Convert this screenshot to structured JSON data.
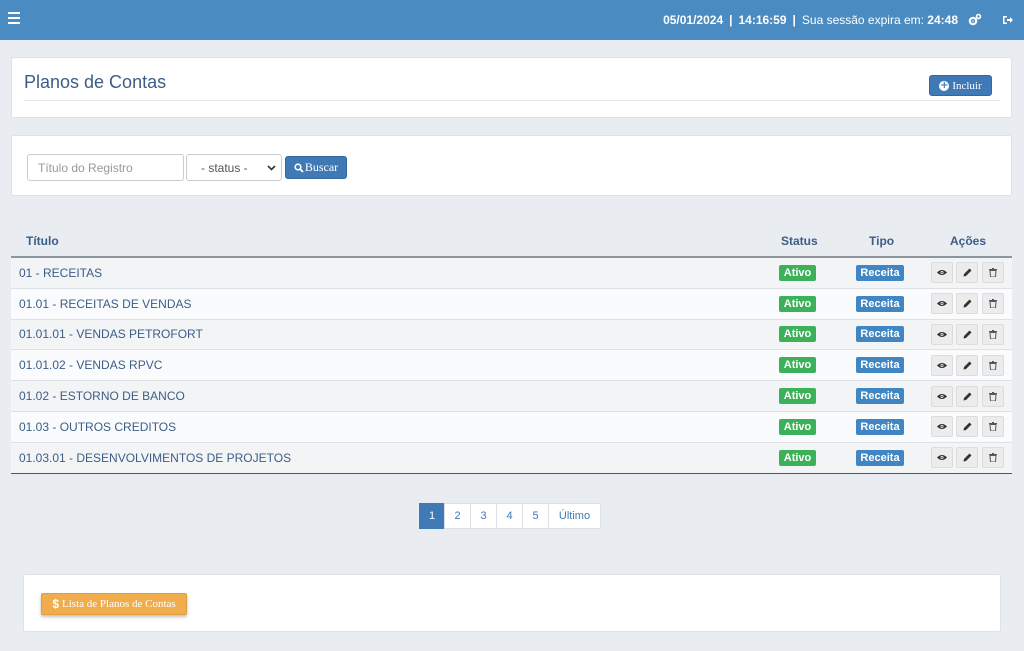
{
  "topbar": {
    "date": "05/01/2024",
    "separator": "|",
    "time": "14:16:59",
    "session_label": "Sua sessão expira em:",
    "session_time": "24:48"
  },
  "header": {
    "title": "Planos de Contas",
    "include_label": "Incluir"
  },
  "search": {
    "placeholder": "Título do Registro",
    "status_selected": "- status -",
    "button_label": "Buscar"
  },
  "table": {
    "columns": {
      "titulo": "Título",
      "status": "Status",
      "tipo": "Tipo",
      "acoes": "Ações"
    },
    "rows": [
      {
        "titulo": "01 - RECEITAS",
        "status": "Ativo",
        "tipo": "Receita"
      },
      {
        "titulo": "01.01 - RECEITAS DE VENDAS",
        "status": "Ativo",
        "tipo": "Receita"
      },
      {
        "titulo": "01.01.01 - VENDAS PETROFORT",
        "status": "Ativo",
        "tipo": "Receita"
      },
      {
        "titulo": "01.01.02 - VENDAS RPVC",
        "status": "Ativo",
        "tipo": "Receita"
      },
      {
        "titulo": "01.02 - ESTORNO DE BANCO",
        "status": "Ativo",
        "tipo": "Receita"
      },
      {
        "titulo": "01.03 - OUTROS CREDITOS",
        "status": "Ativo",
        "tipo": "Receita"
      },
      {
        "titulo": "01.03.01 - DESENVOLVIMENTOS DE PROJETOS",
        "status": "Ativo",
        "tipo": "Receita"
      }
    ]
  },
  "pagination": {
    "pages": [
      "1",
      "2",
      "3",
      "4",
      "5"
    ],
    "last_label": "Último",
    "current": "1"
  },
  "footer": {
    "list_button_label": "Lista de Planos de Contas",
    "list_button_symbol": "$"
  },
  "icons": {
    "menu": "hamburger-icon",
    "settings": "cogs-icon",
    "logout": "sign-out-icon",
    "include": "plus-circle-icon",
    "search": "search-icon",
    "view": "eye-icon",
    "edit": "pencil-icon",
    "delete": "trash-icon"
  },
  "colors": {
    "topbar": "#4a8bc2",
    "primary": "#3f79b6",
    "success": "#3cb15a",
    "info": "#3f86c3",
    "warning": "#f0ad4e",
    "title_text": "#3c5d87"
  }
}
